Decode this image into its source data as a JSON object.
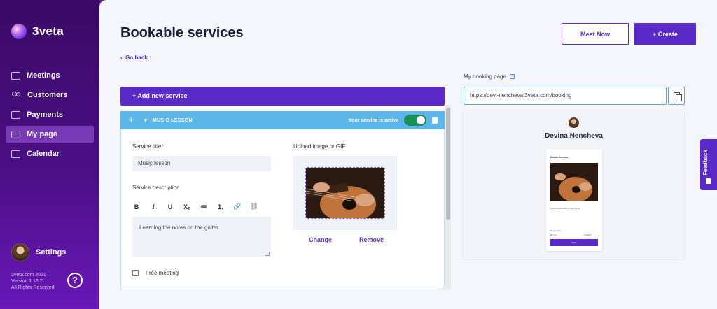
{
  "app": {
    "name": "3veta"
  },
  "sidebar": {
    "items": [
      {
        "label": "Meetings",
        "icon": "meetings-icon"
      },
      {
        "label": "Customers",
        "icon": "customers-icon"
      },
      {
        "label": "Payments",
        "icon": "payments-icon"
      },
      {
        "label": "My page",
        "icon": "my-page-icon",
        "active": true
      },
      {
        "label": "Calendar",
        "icon": "calendar-icon"
      }
    ],
    "settings_label": "Settings",
    "footer": {
      "line1": "3veta.com 2021",
      "line2": "Version 1.16.7",
      "line3": "All Rights Reserved"
    },
    "help_label": "?"
  },
  "header": {
    "title": "Bookable services",
    "go_back": "Go back",
    "meet_now": "Meet Now",
    "create": "+ Create"
  },
  "services": {
    "add_new": "+ Add new service",
    "service": {
      "name": "MUSIC LESSON",
      "active_text": "Your service is active",
      "title_label": "Service title*",
      "title_value": "Music lesson",
      "description_label": "Service description",
      "description_value": "Learning the notes on the guitar",
      "upload_label": "Upload image or GIF",
      "change": "Change",
      "remove": "Remove",
      "free_meeting": "Free meeting",
      "toolbar": [
        "B",
        "I",
        "U",
        "X₂",
        "≔",
        "⒈",
        "🔗",
        "⛓"
      ]
    }
  },
  "booking": {
    "label": "My booking page",
    "url": "https://devi-nencheva.3veta.com/booking",
    "preview": {
      "name": "Devina Nencheva",
      "card_title": "Music lesson",
      "card_desc": "Learning the notes on the guitar",
      "read_more": "Read more",
      "duration": "60 min",
      "price": "10 EUR",
      "book": "Book"
    }
  },
  "feedback_label": "Feedback",
  "colors": {
    "accent": "#5a2ac8",
    "service_header": "#5db6ea",
    "toggle_on": "#1a8f57"
  }
}
